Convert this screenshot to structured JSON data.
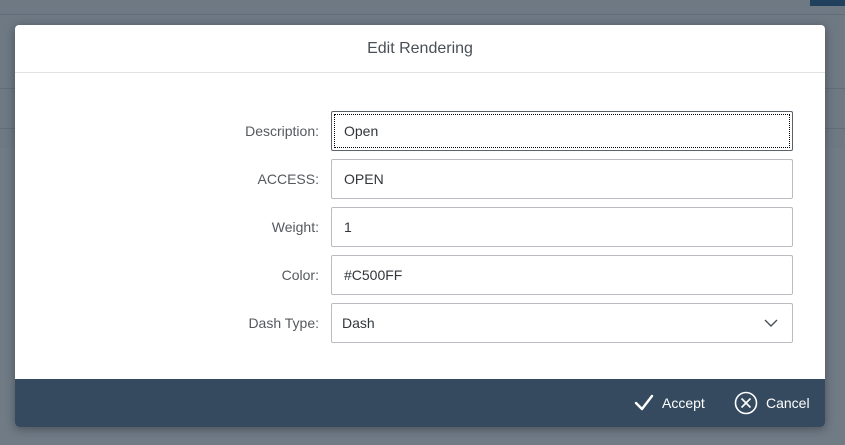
{
  "dialog": {
    "title": "Edit Rendering"
  },
  "form": {
    "description": {
      "label": "Description:",
      "value": "Open"
    },
    "access": {
      "label": "ACCESS:",
      "value": "OPEN"
    },
    "weight": {
      "label": "Weight:",
      "value": "1"
    },
    "color": {
      "label": "Color:",
      "value": "#C500FF"
    },
    "dash_type": {
      "label": "Dash Type:",
      "selected": "Dash"
    }
  },
  "footer": {
    "accept_label": "Accept",
    "cancel_label": "Cancel"
  },
  "icons": {
    "accept": "checkmark-icon",
    "cancel": "circle-x-icon",
    "dropdown": "chevron-down-icon"
  },
  "colors": {
    "footer_bg": "#354a5f",
    "overlay": "#1d2d3e"
  }
}
